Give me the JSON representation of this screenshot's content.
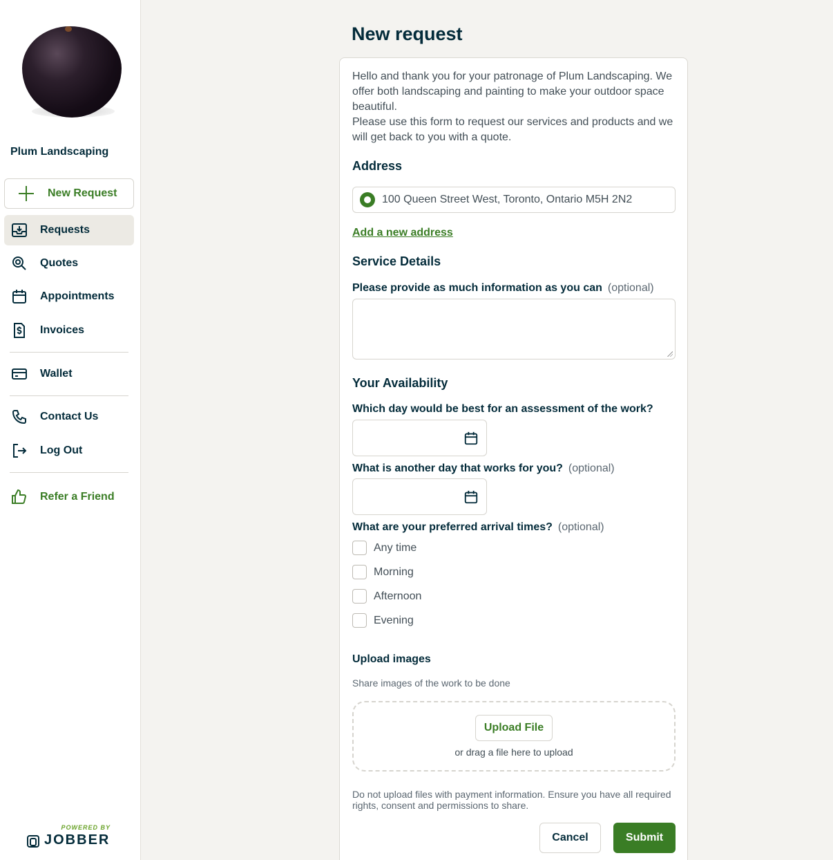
{
  "sidebar": {
    "company_name": "Plum Landscaping",
    "new_request_label": "New Request",
    "items": [
      {
        "label": "Requests",
        "icon": "inbox-download-icon",
        "active": true
      },
      {
        "label": "Quotes",
        "icon": "quote-magnify-icon"
      },
      {
        "label": "Appointments",
        "icon": "calendar-icon"
      },
      {
        "label": "Invoices",
        "icon": "invoice-dollar-icon"
      },
      {
        "label": "Wallet",
        "icon": "credit-card-icon"
      },
      {
        "label": "Contact Us",
        "icon": "phone-icon"
      },
      {
        "label": "Log Out",
        "icon": "logout-icon"
      },
      {
        "label": "Refer a Friend",
        "icon": "thumbs-up-icon"
      }
    ],
    "powered_by": "POWERED BY",
    "brand": "JOBBER"
  },
  "page": {
    "title": "New request",
    "intro": [
      "Hello and thank you for your patronage of Plum Landscaping. We offer both landscaping and painting to make your outdoor space beautiful.",
      "Please use this form to request our services and products and we will get back to you with a quote."
    ],
    "address": {
      "heading": "Address",
      "selected": "100 Queen Street West, Toronto, Ontario M5H 2N2",
      "add_link": "Add a new address"
    },
    "service": {
      "heading": "Service Details",
      "label": "Please provide as much information as you can",
      "optional": "(optional)",
      "value": ""
    },
    "availability": {
      "heading": "Your Availability",
      "day1_label": "Which day would be best for an assessment of the work?",
      "day2_label": "What is another day that works for you?",
      "day2_optional": "(optional)",
      "times_label": "What are your preferred arrival times?",
      "times_optional": "(optional)",
      "options": [
        "Any time",
        "Morning",
        "Afternoon",
        "Evening"
      ]
    },
    "upload": {
      "heading": "Upload images",
      "subtitle": "Share images of the work to be done",
      "button": "Upload File",
      "drag_text": "or drag a file here to upload",
      "disclaimer": "Do not upload files with payment information. Ensure you have all required rights, consent and permissions to share."
    },
    "actions": {
      "cancel": "Cancel",
      "submit": "Submit"
    }
  },
  "colors": {
    "accent": "#3a7d25",
    "text": "#032b3a",
    "background": "#f4f3f0"
  }
}
